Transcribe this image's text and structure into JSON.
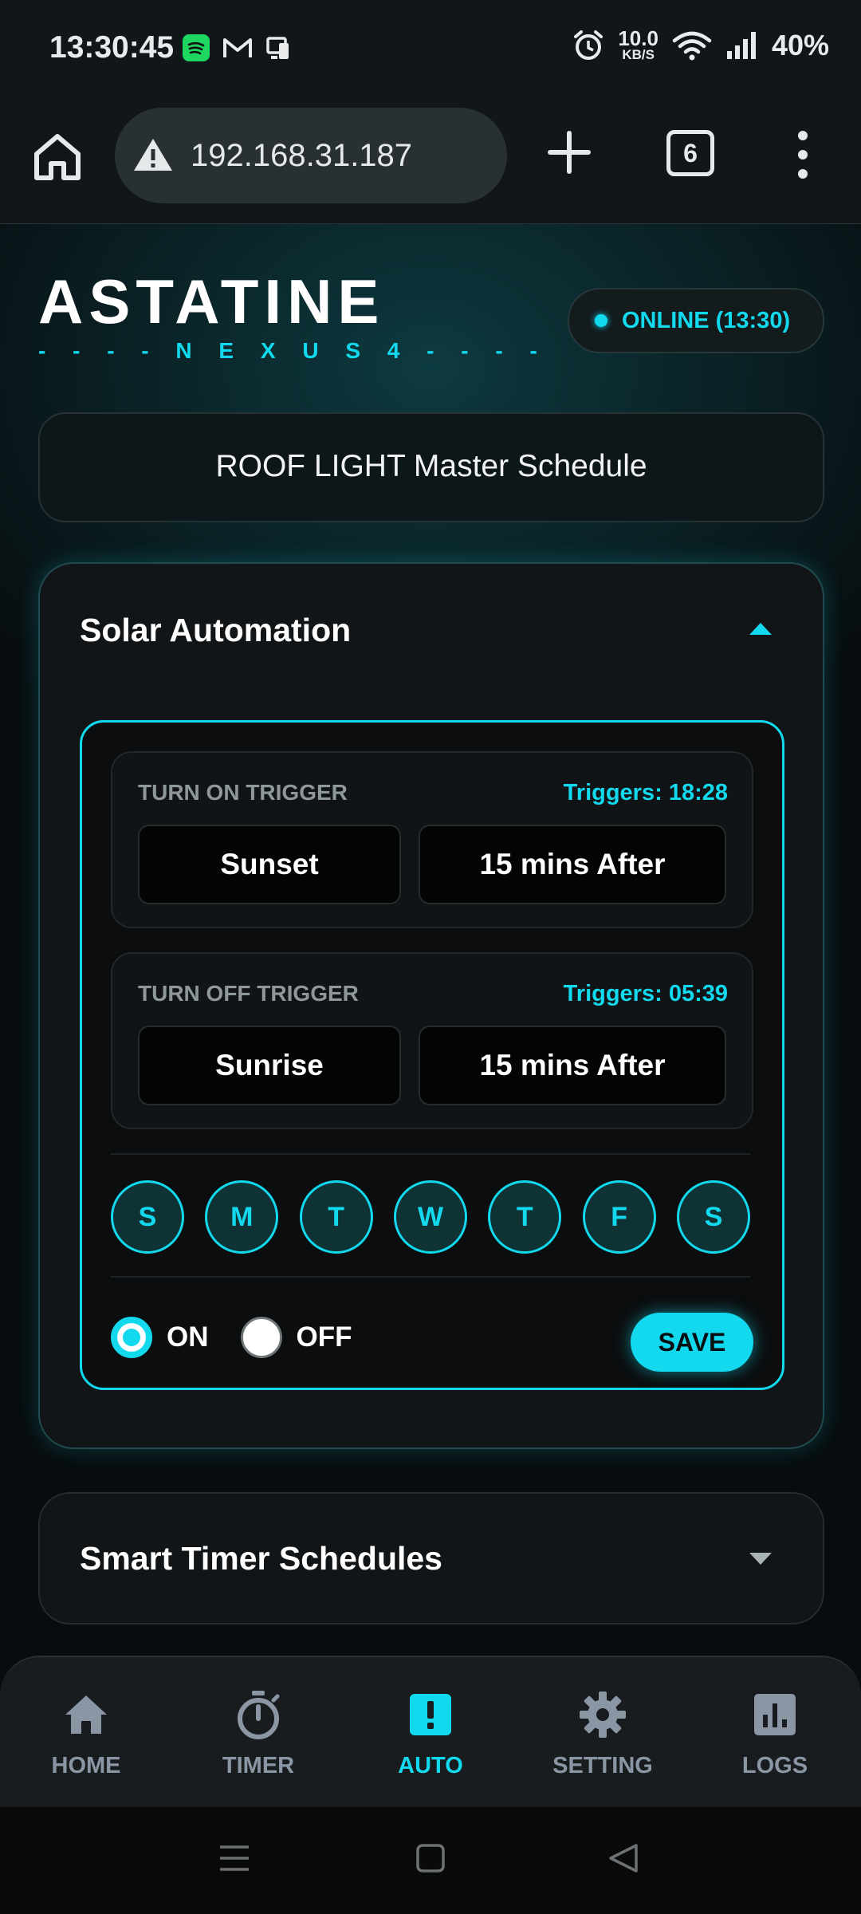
{
  "status_bar": {
    "time": "13:30:45",
    "left_icons": [
      "spotify-icon",
      "gmail-icon",
      "phone-link-icon"
    ],
    "alarm_icon": "alarm-icon",
    "speed_value": "10.0",
    "speed_unit": "KB/S",
    "wifi_icon": "wifi-icon",
    "signal_icon": "signal-icon",
    "battery": "40%"
  },
  "browser": {
    "home_icon": "home-icon",
    "security_icon": "warning-icon",
    "url": "192.168.31.187",
    "new_tab_icon": "plus-icon",
    "tab_count": "6",
    "menu_icon": "more-vertical-icon"
  },
  "header": {
    "brand_title": "ASTATINE",
    "brand_subtitle": "- - - -  N E X U S  4 - - - -",
    "status_text": "ONLINE (13:30)"
  },
  "master_schedule": {
    "title": "ROOF LIGHT Master Schedule"
  },
  "solar": {
    "title": "Solar Automation",
    "turn_on": {
      "label": "TURN ON TRIGGER",
      "triggers": "Triggers: 18:28",
      "event": "Sunset",
      "offset": "15 mins After"
    },
    "turn_off": {
      "label": "TURN OFF TRIGGER",
      "triggers": "Triggers: 05:39",
      "event": "Sunrise",
      "offset": "15 mins After"
    },
    "days": [
      "S",
      "M",
      "T",
      "W",
      "T",
      "F",
      "S"
    ],
    "on_label": "ON",
    "off_label": "OFF",
    "selected_state": "ON",
    "save_label": "SAVE"
  },
  "smart_timer": {
    "title": "Smart Timer Schedules"
  },
  "nav": {
    "items": [
      {
        "label": "HOME",
        "icon": "home-icon"
      },
      {
        "label": "TIMER",
        "icon": "stopwatch-icon"
      },
      {
        "label": "AUTO",
        "icon": "auto-alert-icon"
      },
      {
        "label": "SETTING",
        "icon": "gear-icon"
      },
      {
        "label": "LOGS",
        "icon": "bar-chart-icon"
      }
    ],
    "active": "AUTO"
  },
  "colors": {
    "accent": "#12d9ee",
    "background": "#090c0e",
    "card": "#121517",
    "muted_text": "#8e979a",
    "nav_inactive": "#8b96a5"
  }
}
